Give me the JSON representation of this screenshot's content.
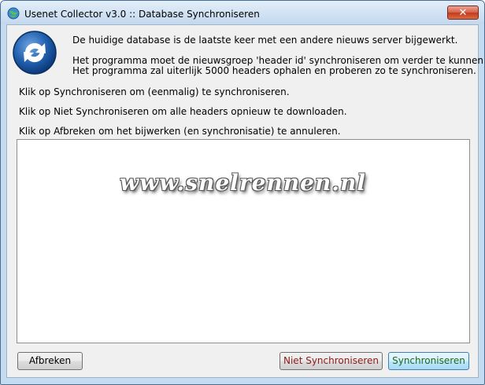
{
  "window": {
    "title": "Usenet Collector v3.0 :: Database Synchroniseren",
    "close_label": "✕"
  },
  "messages": {
    "line1": "De huidige database is de laatste keer met een andere nieuws server bijgewerkt.",
    "line2": "Het programma moet de nieuwsgroep 'header id' synchroniseren om verder te kunnen.",
    "line3": "Het programma zal uiterlijk 5000 headers ophalen en proberen zo te synchroniseren.",
    "line4": "Klik op Synchroniseren om (eenmalig) te synchroniseren.",
    "line5": "Klik op Niet Synchroniseren om alle headers opnieuw te downloaden.",
    "line6": "Klik op Afbreken om het bijwerken (en synchronisatie) te annuleren."
  },
  "log": {
    "watermark": "www.snelrennen.nl"
  },
  "buttons": {
    "cancel": "Afbreken",
    "no_sync": "Niet Synchroniseren",
    "sync": "Synchroniseren"
  },
  "colors": {
    "no_sync_text": "#8b1a1a",
    "sync_text": "#1a6b1a"
  },
  "icons": {
    "app": "globe-icon",
    "sync": "refresh-arrows-icon",
    "close": "close-icon"
  }
}
